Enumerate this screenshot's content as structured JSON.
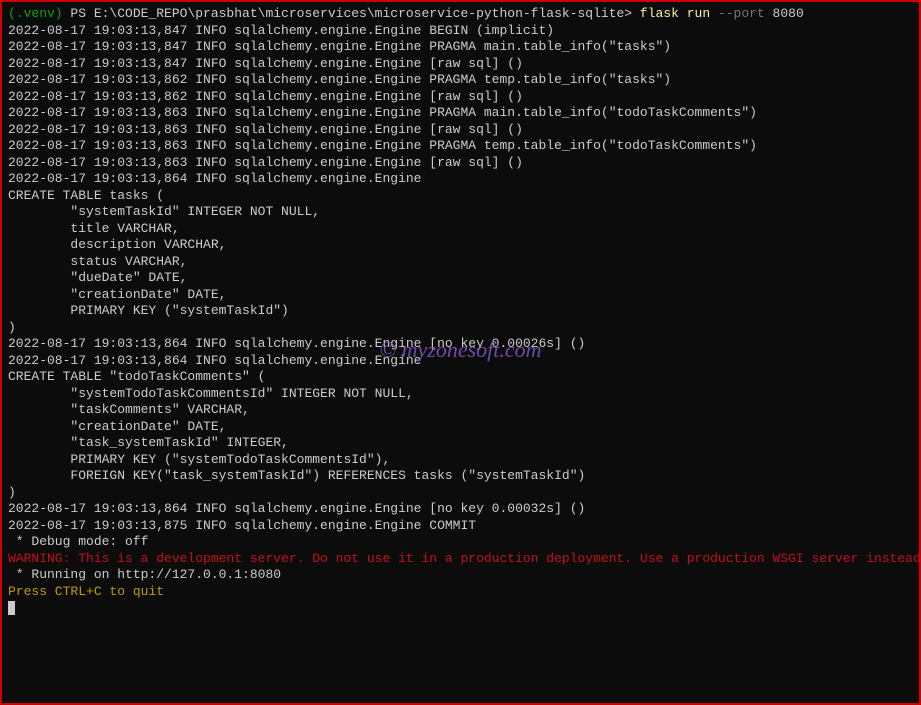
{
  "prompt": {
    "venv": "(.venv)",
    "ps": " PS E:\\CODE_REPO\\prasbhat\\microservices\\microservice-python-flask-sqlite> ",
    "command": "flask run",
    "flag": " --port",
    "arg": " 8080"
  },
  "watermark": "© myzonesoft.com",
  "lines": [
    {
      "cls": "white",
      "text": "2022-08-17 19:03:13,847 INFO sqlalchemy.engine.Engine BEGIN (implicit)"
    },
    {
      "cls": "white",
      "text": "2022-08-17 19:03:13,847 INFO sqlalchemy.engine.Engine PRAGMA main.table_info(\"tasks\")"
    },
    {
      "cls": "white",
      "text": "2022-08-17 19:03:13,847 INFO sqlalchemy.engine.Engine [raw sql] ()"
    },
    {
      "cls": "white",
      "text": "2022-08-17 19:03:13,862 INFO sqlalchemy.engine.Engine PRAGMA temp.table_info(\"tasks\")"
    },
    {
      "cls": "white",
      "text": "2022-08-17 19:03:13,862 INFO sqlalchemy.engine.Engine [raw sql] ()"
    },
    {
      "cls": "white",
      "text": "2022-08-17 19:03:13,863 INFO sqlalchemy.engine.Engine PRAGMA main.table_info(\"todoTaskComments\")"
    },
    {
      "cls": "white",
      "text": "2022-08-17 19:03:13,863 INFO sqlalchemy.engine.Engine [raw sql] ()"
    },
    {
      "cls": "white",
      "text": "2022-08-17 19:03:13,863 INFO sqlalchemy.engine.Engine PRAGMA temp.table_info(\"todoTaskComments\")"
    },
    {
      "cls": "white",
      "text": "2022-08-17 19:03:13,863 INFO sqlalchemy.engine.Engine [raw sql] ()"
    },
    {
      "cls": "white",
      "text": "2022-08-17 19:03:13,864 INFO sqlalchemy.engine.Engine"
    },
    {
      "cls": "white",
      "text": "CREATE TABLE tasks ("
    },
    {
      "cls": "white",
      "text": "        \"systemTaskId\" INTEGER NOT NULL,"
    },
    {
      "cls": "white",
      "text": "        title VARCHAR,"
    },
    {
      "cls": "white",
      "text": "        description VARCHAR,"
    },
    {
      "cls": "white",
      "text": "        status VARCHAR,"
    },
    {
      "cls": "white",
      "text": "        \"dueDate\" DATE,"
    },
    {
      "cls": "white",
      "text": "        \"creationDate\" DATE,"
    },
    {
      "cls": "white",
      "text": "        PRIMARY KEY (\"systemTaskId\")"
    },
    {
      "cls": "white",
      "text": ")"
    },
    {
      "cls": "white",
      "text": ""
    },
    {
      "cls": "white",
      "text": ""
    },
    {
      "cls": "white",
      "text": "2022-08-17 19:03:13,864 INFO sqlalchemy.engine.Engine [no key 0.00026s] ()"
    },
    {
      "cls": "white",
      "text": "2022-08-17 19:03:13,864 INFO sqlalchemy.engine.Engine"
    },
    {
      "cls": "white",
      "text": "CREATE TABLE \"todoTaskComments\" ("
    },
    {
      "cls": "white",
      "text": "        \"systemTodoTaskCommentsId\" INTEGER NOT NULL,"
    },
    {
      "cls": "white",
      "text": "        \"taskComments\" VARCHAR,"
    },
    {
      "cls": "white",
      "text": "        \"creationDate\" DATE,"
    },
    {
      "cls": "white",
      "text": "        \"task_systemTaskId\" INTEGER,"
    },
    {
      "cls": "white",
      "text": "        PRIMARY KEY (\"systemTodoTaskCommentsId\"),"
    },
    {
      "cls": "white",
      "text": "        FOREIGN KEY(\"task_systemTaskId\") REFERENCES tasks (\"systemTaskId\")"
    },
    {
      "cls": "white",
      "text": ")"
    },
    {
      "cls": "white",
      "text": ""
    },
    {
      "cls": "white",
      "text": ""
    },
    {
      "cls": "white",
      "text": "2022-08-17 19:03:13,864 INFO sqlalchemy.engine.Engine [no key 0.00032s] ()"
    },
    {
      "cls": "white",
      "text": "2022-08-17 19:03:13,875 INFO sqlalchemy.engine.Engine COMMIT"
    },
    {
      "cls": "white",
      "text": " * Debug mode: off"
    },
    {
      "cls": "warn",
      "text": "WARNING: This is a development server. Do not use it in a production deployment. Use a production WSGI server instead."
    },
    {
      "cls": "white",
      "text": " * Running on http://127.0.0.1:8080"
    },
    {
      "cls": "hint",
      "text": "Press CTRL+C to quit"
    }
  ]
}
